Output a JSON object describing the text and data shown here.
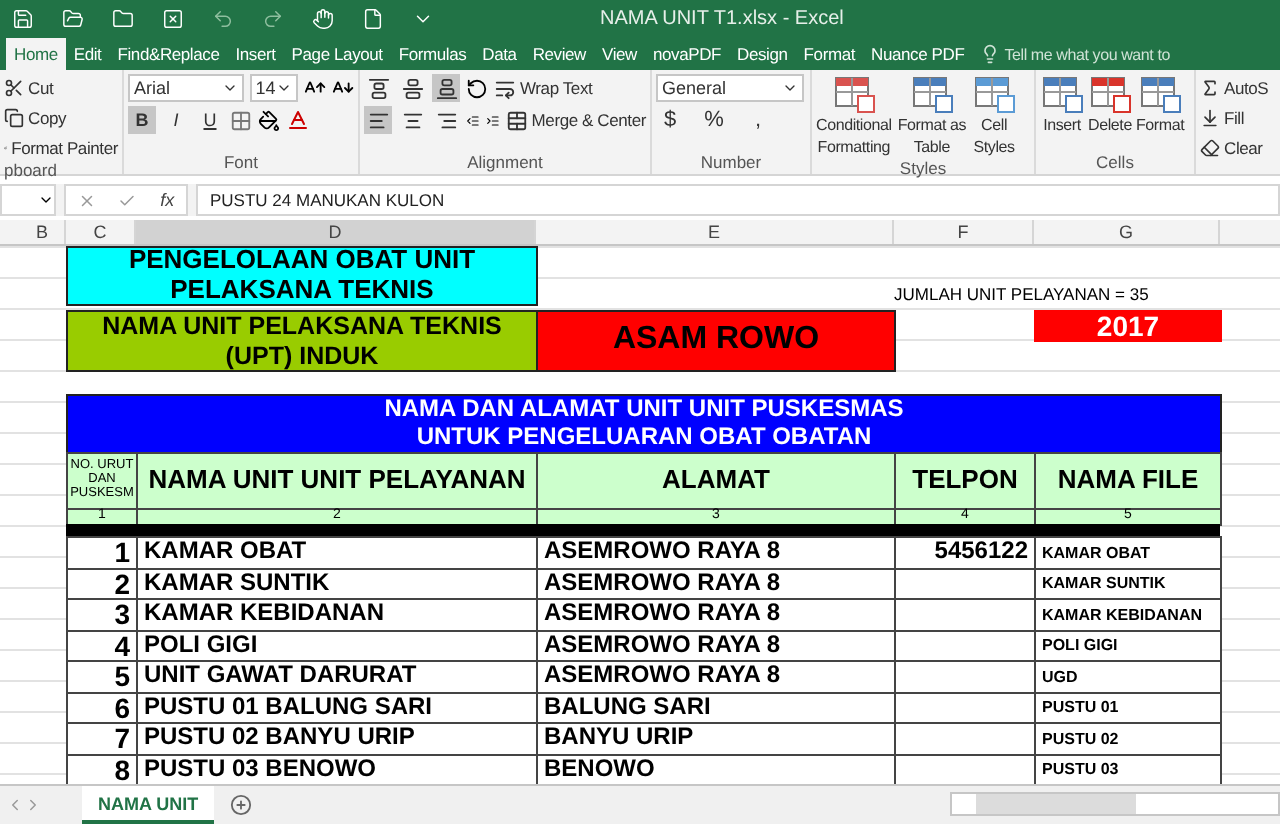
{
  "window": {
    "title": "NAMA UNIT T1.xlsx - Excel"
  },
  "tabs": [
    {
      "label": "Home",
      "selected": true
    },
    {
      "label": "Edit",
      "selected": false
    },
    {
      "label": "Find&Replace",
      "selected": false
    },
    {
      "label": "Insert",
      "selected": false
    },
    {
      "label": "Page Layout",
      "selected": false
    },
    {
      "label": "Formulas",
      "selected": false
    },
    {
      "label": "Data",
      "selected": false
    },
    {
      "label": "Review",
      "selected": false
    },
    {
      "label": "View",
      "selected": false
    },
    {
      "label": "novaPDF",
      "selected": false
    },
    {
      "label": "Design",
      "selected": false
    },
    {
      "label": "Format",
      "selected": false
    },
    {
      "label": "Nuance PDF",
      "selected": false
    }
  ],
  "tell_me": "Tell me what you want to",
  "ribbon": {
    "clipboard": {
      "label": "pboard",
      "items": [
        {
          "kind": "cut",
          "label": "Cut"
        },
        {
          "kind": "copy",
          "label": "Copy"
        },
        {
          "kind": "painter",
          "label": "Format Painter"
        }
      ]
    },
    "font": {
      "label": "Font",
      "name": "Arial",
      "size": "14",
      "styles": [
        {
          "label": "B",
          "selected": true
        },
        {
          "label": "I",
          "selected": false
        },
        {
          "label": "U",
          "selected": false
        }
      ]
    },
    "alignment": {
      "label": "Alignment",
      "vertical": [
        {
          "kind": "top",
          "selected": false
        },
        {
          "kind": "middle",
          "selected": false
        },
        {
          "kind": "bottom",
          "selected": true
        }
      ],
      "horizontal": [
        {
          "kind": "left",
          "selected": true
        },
        {
          "kind": "center",
          "selected": false
        },
        {
          "kind": "right",
          "selected": false
        }
      ],
      "wrap_text": "Wrap Text",
      "merge": "Merge & Center"
    },
    "number": {
      "label": "Number",
      "format": "General",
      "symbols": [
        "$",
        "%",
        ","
      ]
    },
    "styles": {
      "label": "Styles",
      "buttons": [
        {
          "kind": "conditional",
          "lines": [
            "Conditional",
            "Formatting"
          ]
        },
        {
          "kind": "table",
          "lines": [
            "Format as",
            "Table"
          ]
        },
        {
          "kind": "cellstyles",
          "lines": [
            "Cell",
            "Styles"
          ]
        }
      ]
    },
    "cells": {
      "label": "Cells",
      "buttons": [
        {
          "kind": "insert",
          "label": "Insert"
        },
        {
          "kind": "delete",
          "label": "Delete"
        },
        {
          "kind": "format",
          "label": "Format"
        }
      ]
    },
    "editing": [
      {
        "kind": "sum",
        "label": "AutoS"
      },
      {
        "kind": "fill",
        "label": "Fill"
      },
      {
        "kind": "clear",
        "label": "Clear"
      }
    ]
  },
  "formula_bar": {
    "fx": "fx",
    "value": "PUSTU  24  MANUKAN KULON"
  },
  "columns": [
    {
      "label": "B",
      "selected": false
    },
    {
      "label": "C",
      "selected": false
    },
    {
      "label": "D",
      "selected": true
    },
    {
      "label": "E",
      "selected": false
    },
    {
      "label": "F",
      "selected": false
    },
    {
      "label": "G",
      "selected": false
    }
  ],
  "sheet": {
    "title": "PENGELOLAAN OBAT  UNIT PELAKSANA TEKNIS",
    "total": "JUMLAH UNIT PELAYANAN  =  35",
    "unit_label": "NAMA UNIT PELAKSANA TEKNIS (UPT) INDUK",
    "unit_name": "ASAM ROWO",
    "year": "2017",
    "table_title": [
      "NAMA  DAN ALAMAT  UNIT UNIT PUSKESMAS",
      "UNTUK PENGELUARAN OBAT OBATAN"
    ],
    "headers": [
      "NO. URUT DAN PUSKESM",
      "NAMA  UNIT UNIT PELAYANAN",
      "ALAMAT",
      "TELPON",
      "NAMA FILE"
    ],
    "header_numbers": [
      "1",
      "2",
      "3",
      "4",
      "5"
    ],
    "rows": [
      {
        "no": "1",
        "name": "KAMAR OBAT",
        "address": "ASEMROWO RAYA 8",
        "phone": "5456122",
        "file": "KAMAR OBAT"
      },
      {
        "no": "2",
        "name": "KAMAR SUNTIK",
        "address": "ASEMROWO RAYA 8",
        "file": "KAMAR SUNTIK"
      },
      {
        "no": "3",
        "name": "KAMAR KEBIDANAN",
        "address": "ASEMROWO RAYA 8",
        "file": "KAMAR KEBIDANAN"
      },
      {
        "no": "4",
        "name": "POLI  GIGI",
        "address": "ASEMROWO RAYA 8",
        "file": "POLI  GIGI"
      },
      {
        "no": "5",
        "name": "UNIT GAWAT DARURAT",
        "address": "ASEMROWO RAYA 8",
        "file": "UGD"
      },
      {
        "no": "6",
        "name": "PUSTU  01  BALUNG SARI",
        "address": "BALUNG SARI",
        "file": "PUSTU  01"
      },
      {
        "no": "7",
        "name": "PUSTU  02  BANYU URIP",
        "address": "BANYU URIP",
        "file": "PUSTU  02"
      },
      {
        "no": "8",
        "name": "PUSTU  03  BENOWO",
        "address": "BENOWO",
        "file": "PUSTU  03"
      }
    ]
  },
  "sheet_tabs": [
    {
      "label": "NAMA UNIT",
      "selected": true
    }
  ]
}
